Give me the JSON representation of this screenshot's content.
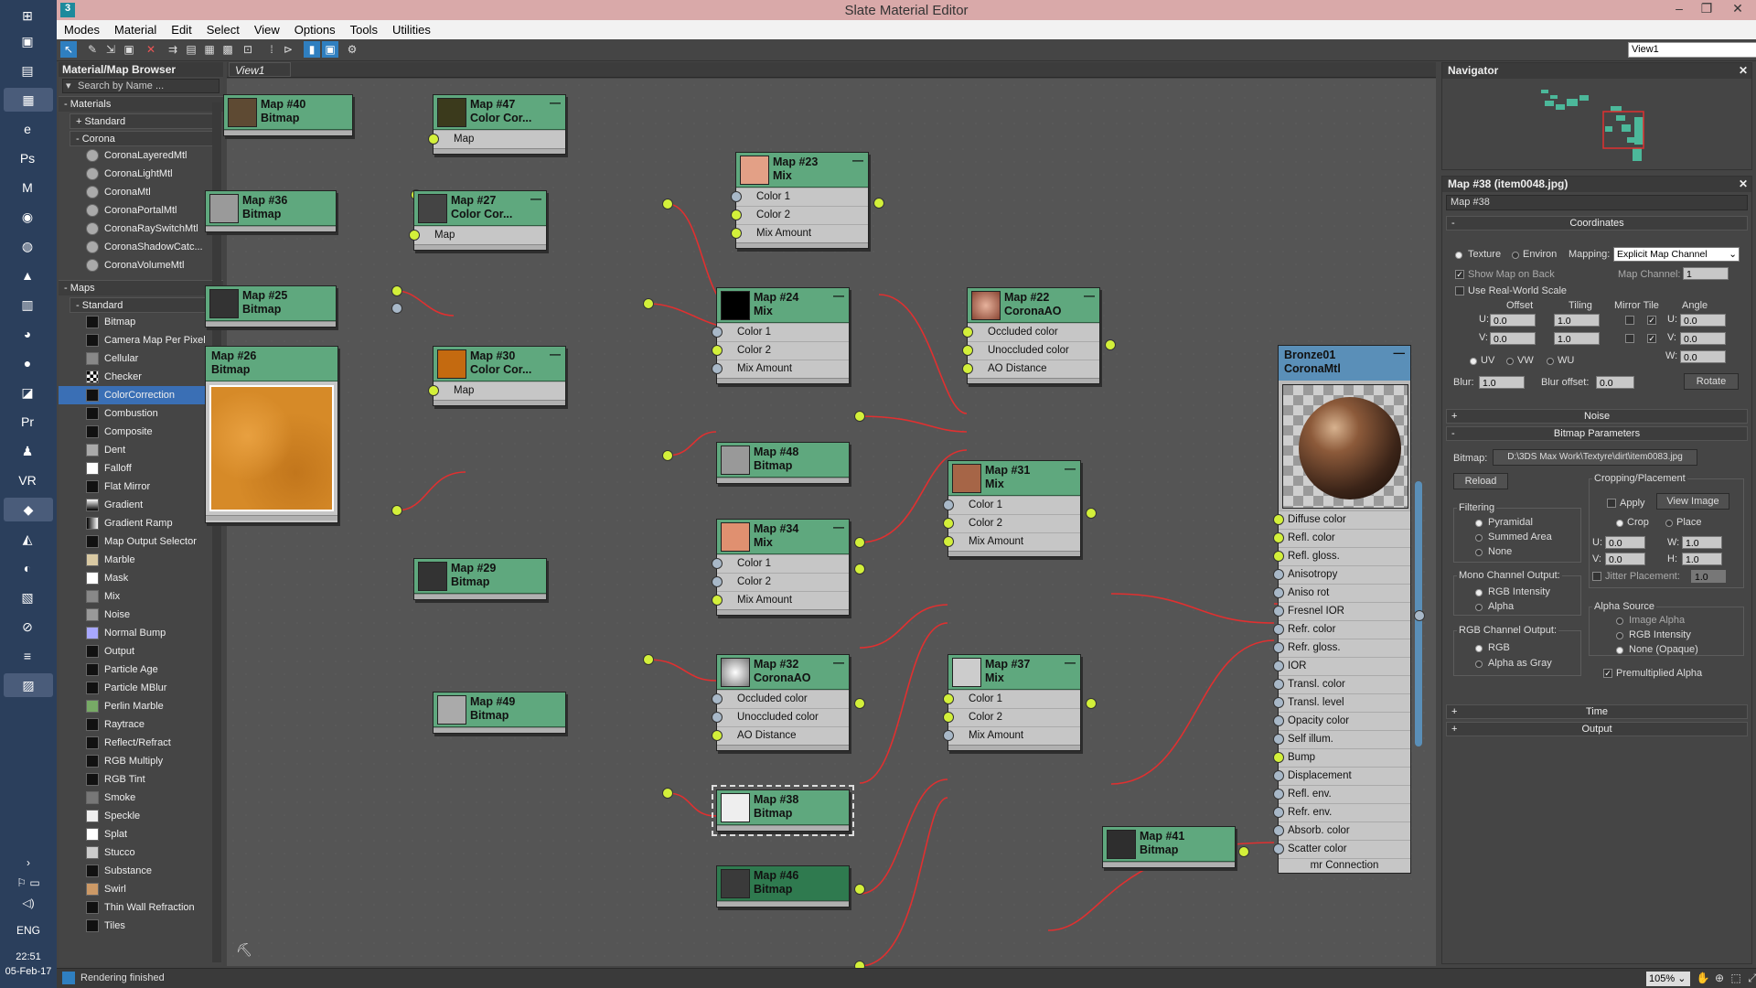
{
  "window": {
    "title": "Slate Material Editor"
  },
  "taskbar": {
    "lang": "ENG",
    "time": "22:51",
    "date": "05-Feb-17"
  },
  "menu": [
    "Modes",
    "Material",
    "Edit",
    "Select",
    "View",
    "Options",
    "Tools",
    "Utilities"
  ],
  "toolbar": {
    "view_select": "View1"
  },
  "browser": {
    "title": "Material/Map Browser",
    "search_placeholder": "Search by Name ...",
    "materials": "Materials",
    "standard": "+ Standard",
    "corona": "Corona",
    "corona_items": [
      "CoronaLayeredMtl",
      "CoronaLightMtl",
      "CoronaMtl",
      "CoronaPortalMtl",
      "CoronaRaySwitchMtl",
      "CoronaShadowCatc...",
      "CoronaVolumeMtl"
    ],
    "maps": "Maps",
    "maps_standard": "Standard",
    "map_items": [
      "Bitmap",
      "Camera Map Per Pixel",
      "Cellular",
      "Checker",
      "ColorCorrection",
      "Combustion",
      "Composite",
      "Dent",
      "Falloff",
      "Flat Mirror",
      "Gradient",
      "Gradient Ramp",
      "Map Output Selector",
      "Marble",
      "Mask",
      "Mix",
      "Noise",
      "Normal Bump",
      "Output",
      "Particle Age",
      "Particle MBlur",
      "Perlin Marble",
      "Raytrace",
      "Reflect/Refract",
      "RGB Multiply",
      "RGB Tint",
      "Smoke",
      "Speckle",
      "Splat",
      "Stucco",
      "Substance",
      "Swirl",
      "Thin Wall Refraction",
      "Tiles"
    ],
    "selected": "ColorCorrection"
  },
  "view": {
    "tab": "View1"
  },
  "nodes": [
    {
      "id": "n40",
      "title": "Map #40",
      "type": "Bitmap",
      "rows": []
    },
    {
      "id": "n47",
      "title": "Map #47",
      "type": "Color Cor...",
      "rows": [
        "Map"
      ]
    },
    {
      "id": "n36",
      "title": "Map #36",
      "type": "Bitmap",
      "rows": []
    },
    {
      "id": "n27",
      "title": "Map #27",
      "type": "Color Cor...",
      "rows": [
        "Map"
      ]
    },
    {
      "id": "n23",
      "title": "Map #23",
      "type": "Mix",
      "rows": [
        "Color 1",
        "Color 2",
        "Mix Amount"
      ]
    },
    {
      "id": "n25",
      "title": "Map #25",
      "type": "Bitmap",
      "rows": []
    },
    {
      "id": "n24",
      "title": "Map #24",
      "type": "Mix",
      "rows": [
        "Color 1",
        "Color 2",
        "Mix Amount"
      ]
    },
    {
      "id": "n22",
      "title": "Map #22",
      "type": "CoronaAO",
      "rows": [
        "Occluded color",
        "Unoccluded color",
        "AO Distance"
      ]
    },
    {
      "id": "n26",
      "title": "Map #26",
      "type": "Bitmap",
      "rows": []
    },
    {
      "id": "n30",
      "title": "Map #30",
      "type": "Color Cor...",
      "rows": [
        "Map"
      ]
    },
    {
      "id": "n48",
      "title": "Map #48",
      "type": "Bitmap",
      "rows": []
    },
    {
      "id": "n31",
      "title": "Map #31",
      "type": "Mix",
      "rows": [
        "Color 1",
        "Color 2",
        "Mix Amount"
      ]
    },
    {
      "id": "n34",
      "title": "Map #34",
      "type": "Mix",
      "rows": [
        "Color 1",
        "Color 2",
        "Mix Amount"
      ]
    },
    {
      "id": "n29",
      "title": "Map #29",
      "type": "Bitmap",
      "rows": []
    },
    {
      "id": "n32",
      "title": "Map #32",
      "type": "CoronaAO",
      "rows": [
        "Occluded color",
        "Unoccluded color",
        "AO Distance"
      ]
    },
    {
      "id": "n49",
      "title": "Map #49",
      "type": "Bitmap",
      "rows": []
    },
    {
      "id": "n37",
      "title": "Map #37",
      "type": "Mix",
      "rows": [
        "Color 1",
        "Color 2",
        "Mix Amount"
      ]
    },
    {
      "id": "n38",
      "title": "Map #38",
      "type": "Bitmap",
      "rows": []
    },
    {
      "id": "n46",
      "title": "Map #46",
      "type": "Bitmap",
      "rows": []
    },
    {
      "id": "n41",
      "title": "Map #41",
      "type": "Bitmap",
      "rows": []
    }
  ],
  "material": {
    "title": "Bronze01",
    "type": "CoronaMtl",
    "slots": [
      "Diffuse color",
      "Refl. color",
      "Refl. gloss.",
      "Anisotropy",
      "Aniso rot",
      "Fresnel IOR",
      "Refr. color",
      "Refr. gloss.",
      "IOR",
      "Transl. color",
      "Transl. level",
      "Opacity color",
      "Self illum.",
      "Bump",
      "Displacement",
      "Refl. env.",
      "Refr. env.",
      "Absorb. color",
      "Scatter color"
    ],
    "footer": "mr Connection"
  },
  "navigator": {
    "title": "Navigator"
  },
  "params": {
    "title": "Map #38 (item0048.jpg)",
    "name": "Map #38",
    "coordinates": "Coordinates",
    "texture": "Texture",
    "environ": "Environ",
    "mapping_lbl": "Mapping:",
    "mapping": "Explicit Map Channel",
    "show_map": "Show Map on Back",
    "map_channel_lbl": "Map Channel:",
    "map_channel": "1",
    "real_world": "Use Real-World Scale",
    "offset": "Offset",
    "tiling": "Tiling",
    "mirror_tile": "Mirror Tile",
    "angle": "Angle",
    "u": "U:",
    "v": "V:",
    "w": "W:",
    "u_off": "0.0",
    "v_off": "0.0",
    "u_tile": "1.0",
    "v_tile": "1.0",
    "u_ang": "0.0",
    "v_ang": "0.0",
    "w_ang": "0.0",
    "uv": "UV",
    "vw": "VW",
    "wu": "WU",
    "blur_lbl": "Blur:",
    "blur": "1.0",
    "blur_off_lbl": "Blur offset:",
    "blur_off": "0.0",
    "rotate": "Rotate",
    "noise": "Noise",
    "bitmap_params": "Bitmap Parameters",
    "bitmap_lbl": "Bitmap:",
    "bitmap_path": "D:\\3DS Max Work\\Textyre\\dirt\\item0083.jpg",
    "reload": "Reload",
    "crop_place": "Cropping/Placement",
    "apply": "Apply",
    "view_image": "View Image",
    "crop": "Crop",
    "place": "Place",
    "filtering": "Filtering",
    "pyramidal": "Pyramidal",
    "summed": "Summed Area",
    "none": "None",
    "cu": "U:",
    "cu_v": "0.0",
    "cw": "W:",
    "cw_v": "1.0",
    "cv": "V:",
    "cv_v": "0.0",
    "ch": "H:",
    "ch_v": "1.0",
    "jitter": "Jitter Placement:",
    "jitter_v": "1.0",
    "mono_out": "Mono Channel Output:",
    "rgb_int": "RGB Intensity",
    "alpha": "Alpha",
    "alpha_src": "Alpha Source",
    "img_alpha": "Image Alpha",
    "rgb_int2": "RGB Intensity",
    "none_opaque": "None (Opaque)",
    "rgb_out": "RGB Channel Output:",
    "rgb": "RGB",
    "alpha_gray": "Alpha as Gray",
    "premult": "Premultiplied Alpha",
    "time": "Time",
    "output": "Output"
  },
  "status": {
    "message": "Rendering finished",
    "zoom": "105%"
  }
}
